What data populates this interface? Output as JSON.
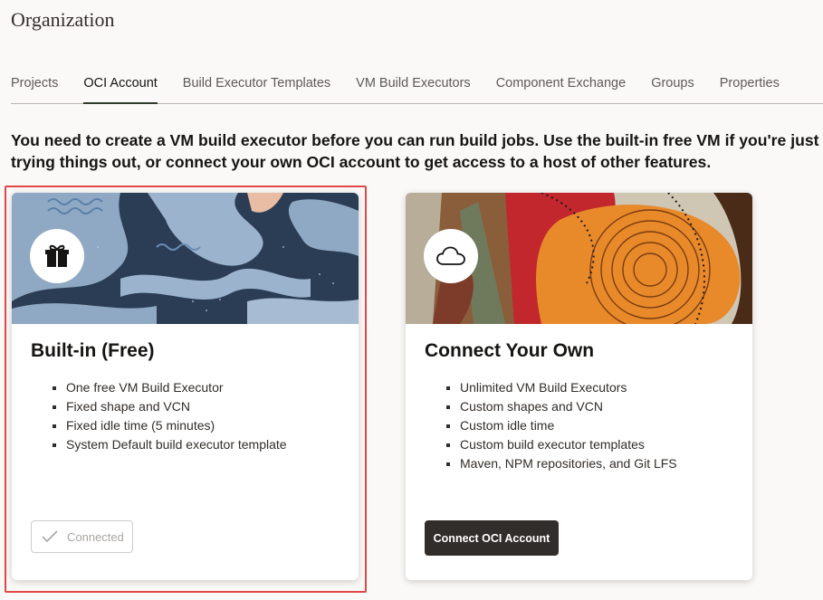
{
  "page": {
    "title": "Organization",
    "intro": "You need to create a VM build executor before you can run build jobs. Use the built-in free VM if you're just trying things out, or connect your own OCI account to get access to a host of other features."
  },
  "tabs": [
    {
      "label": "Projects",
      "active": false
    },
    {
      "label": "OCI Account",
      "active": true
    },
    {
      "label": "Build Executor Templates",
      "active": false
    },
    {
      "label": "VM Build Executors",
      "active": false
    },
    {
      "label": "Component Exchange",
      "active": false
    },
    {
      "label": "Groups",
      "active": false
    },
    {
      "label": "Properties",
      "active": false
    }
  ],
  "cards": {
    "builtin": {
      "title": "Built-in (Free)",
      "icon": "gift-icon",
      "features": [
        "One free VM Build Executor",
        "Fixed shape and VCN",
        "Fixed idle time (5 minutes)",
        "System Default build executor template"
      ],
      "button_label": "Connected",
      "selected": true
    },
    "own": {
      "title": "Connect Your Own",
      "icon": "cloud-icon",
      "features": [
        "Unlimited VM Build Executors",
        "Custom shapes and VCN",
        "Custom idle time",
        "Custom build executor templates",
        "Maven, NPM repositories, and Git LFS"
      ],
      "button_label": "Connect OCI Account"
    }
  },
  "colors": {
    "accent_dark": "#312d2a",
    "selection_outline": "#e04848",
    "tab_underline": "#2e3b2f",
    "page_background": "#fbf9f8"
  }
}
